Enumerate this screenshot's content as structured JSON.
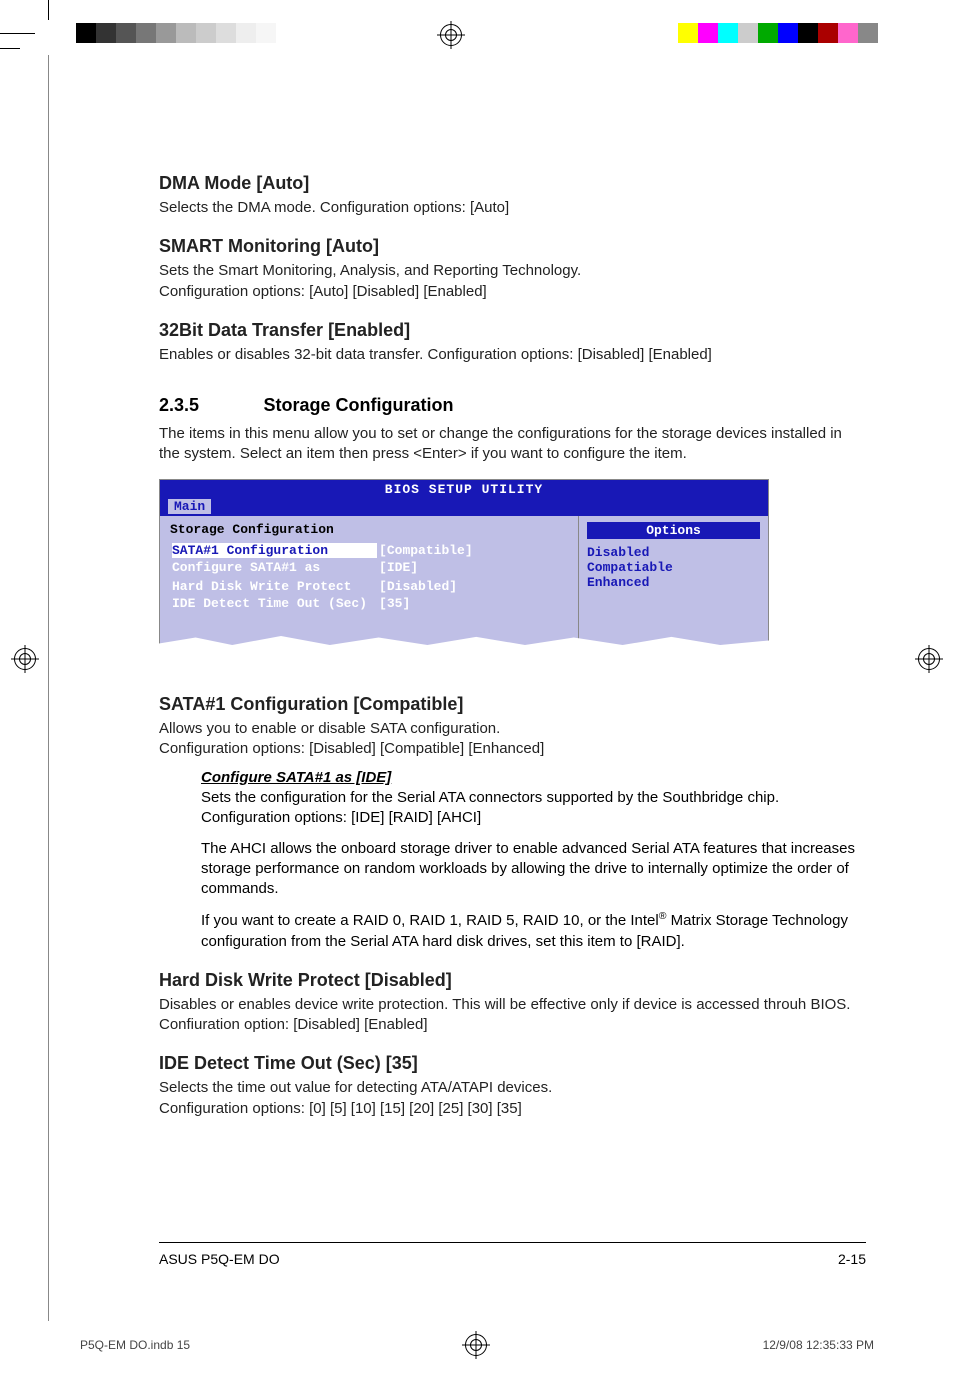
{
  "colorbar": {
    "left": [
      "#000000",
      "#333333",
      "#555555",
      "#777777",
      "#999999",
      "#bbbbbb",
      "#cccccc",
      "#dddddd",
      "#eeeeee",
      "#f6f6f6",
      "#ffffff",
      "#ffffff",
      "#ffffff",
      "#ffffff",
      "#ffffff"
    ],
    "right": [
      "#ffff00",
      "#ff00ff",
      "#00ffff",
      "#cccccc",
      "#00aa00",
      "#0000ff",
      "#000000",
      "#aa0000",
      "#ff66cc",
      "#888888"
    ]
  },
  "items": {
    "dma": {
      "title": "DMA Mode [Auto]",
      "body": "Selects the DMA mode. Configuration options: [Auto]"
    },
    "smart": {
      "title": "SMART Monitoring [Auto]",
      "body": "Sets the Smart Monitoring, Analysis, and Reporting Technology.\nConfiguration options: [Auto] [Disabled] [Enabled]"
    },
    "bit32": {
      "title": "32Bit Data Transfer [Enabled]",
      "body": "Enables or disables 32-bit data transfer. Configuration options: [Disabled] [Enabled]"
    }
  },
  "section": {
    "num": "2.3.5",
    "title": "Storage Configuration",
    "intro": "The items in this menu allow you to set or change the configurations for the storage devices installed in the system. Select an item then press <Enter> if you want to configure the item."
  },
  "bios": {
    "title": "BIOS SETUP UTILITY",
    "tab": "Main",
    "header": "Storage Configuration",
    "rows": [
      {
        "label": "SATA#1 Configuration",
        "value": "[Compatible]",
        "selected": true
      },
      {
        "label": "   Configure SATA#1 as",
        "value": "[IDE]",
        "selected": false
      },
      {
        "label": "",
        "value": "",
        "selected": false
      },
      {
        "label": "Hard Disk Write Protect",
        "value": "[Disabled]",
        "selected": false
      },
      {
        "label": "IDE Detect Time Out (Sec)",
        "value": "[35]",
        "selected": false
      }
    ],
    "options_header": "Options",
    "options": [
      "Disabled",
      "Compatiable",
      "Enhanced"
    ]
  },
  "sata1": {
    "title": "SATA#1 Configuration [Compatible]",
    "body": "Allows you to enable or disable SATA configuration.\nConfiguration options: [Disabled] [Compatible] [Enhanced]"
  },
  "cfgas": {
    "title": "Configure SATA#1 as [IDE]",
    "p1": "Sets the configuration for the Serial ATA connectors supported by the Southbridge chip. Configuration options: [IDE] [RAID] [AHCI]",
    "p2": "The AHCI allows the onboard storage driver to enable advanced Serial ATA features that increases storage performance on random workloads by allowing the drive to internally optimize the order of commands.",
    "p3a": "If you want to create a RAID 0, RAID 1,  RAID 5,  RAID 10, or the Intel",
    "p3sup": "®",
    "p3b": " Matrix Storage Technology configuration from the Serial ATA hard disk drives, set this item to [RAID]."
  },
  "hdwp": {
    "title": "Hard Disk Write Protect [Disabled]",
    "body": "Disables or enables device write protection. This will be effective only if device is accessed throuh BIOS. Confiuration option: [Disabled] [Enabled]"
  },
  "ide": {
    "title": "IDE Detect Time Out (Sec) [35]",
    "body": "Selects the time out value for detecting ATA/ATAPI devices.\nConfiguration options: [0] [5] [10] [15] [20] [25] [30] [35]"
  },
  "footer": {
    "product": "ASUS P5Q-EM DO",
    "page": "2-15"
  },
  "bleed": {
    "file": "P5Q-EM DO.indb   15",
    "stamp": "12/9/08   12:35:33 PM"
  }
}
